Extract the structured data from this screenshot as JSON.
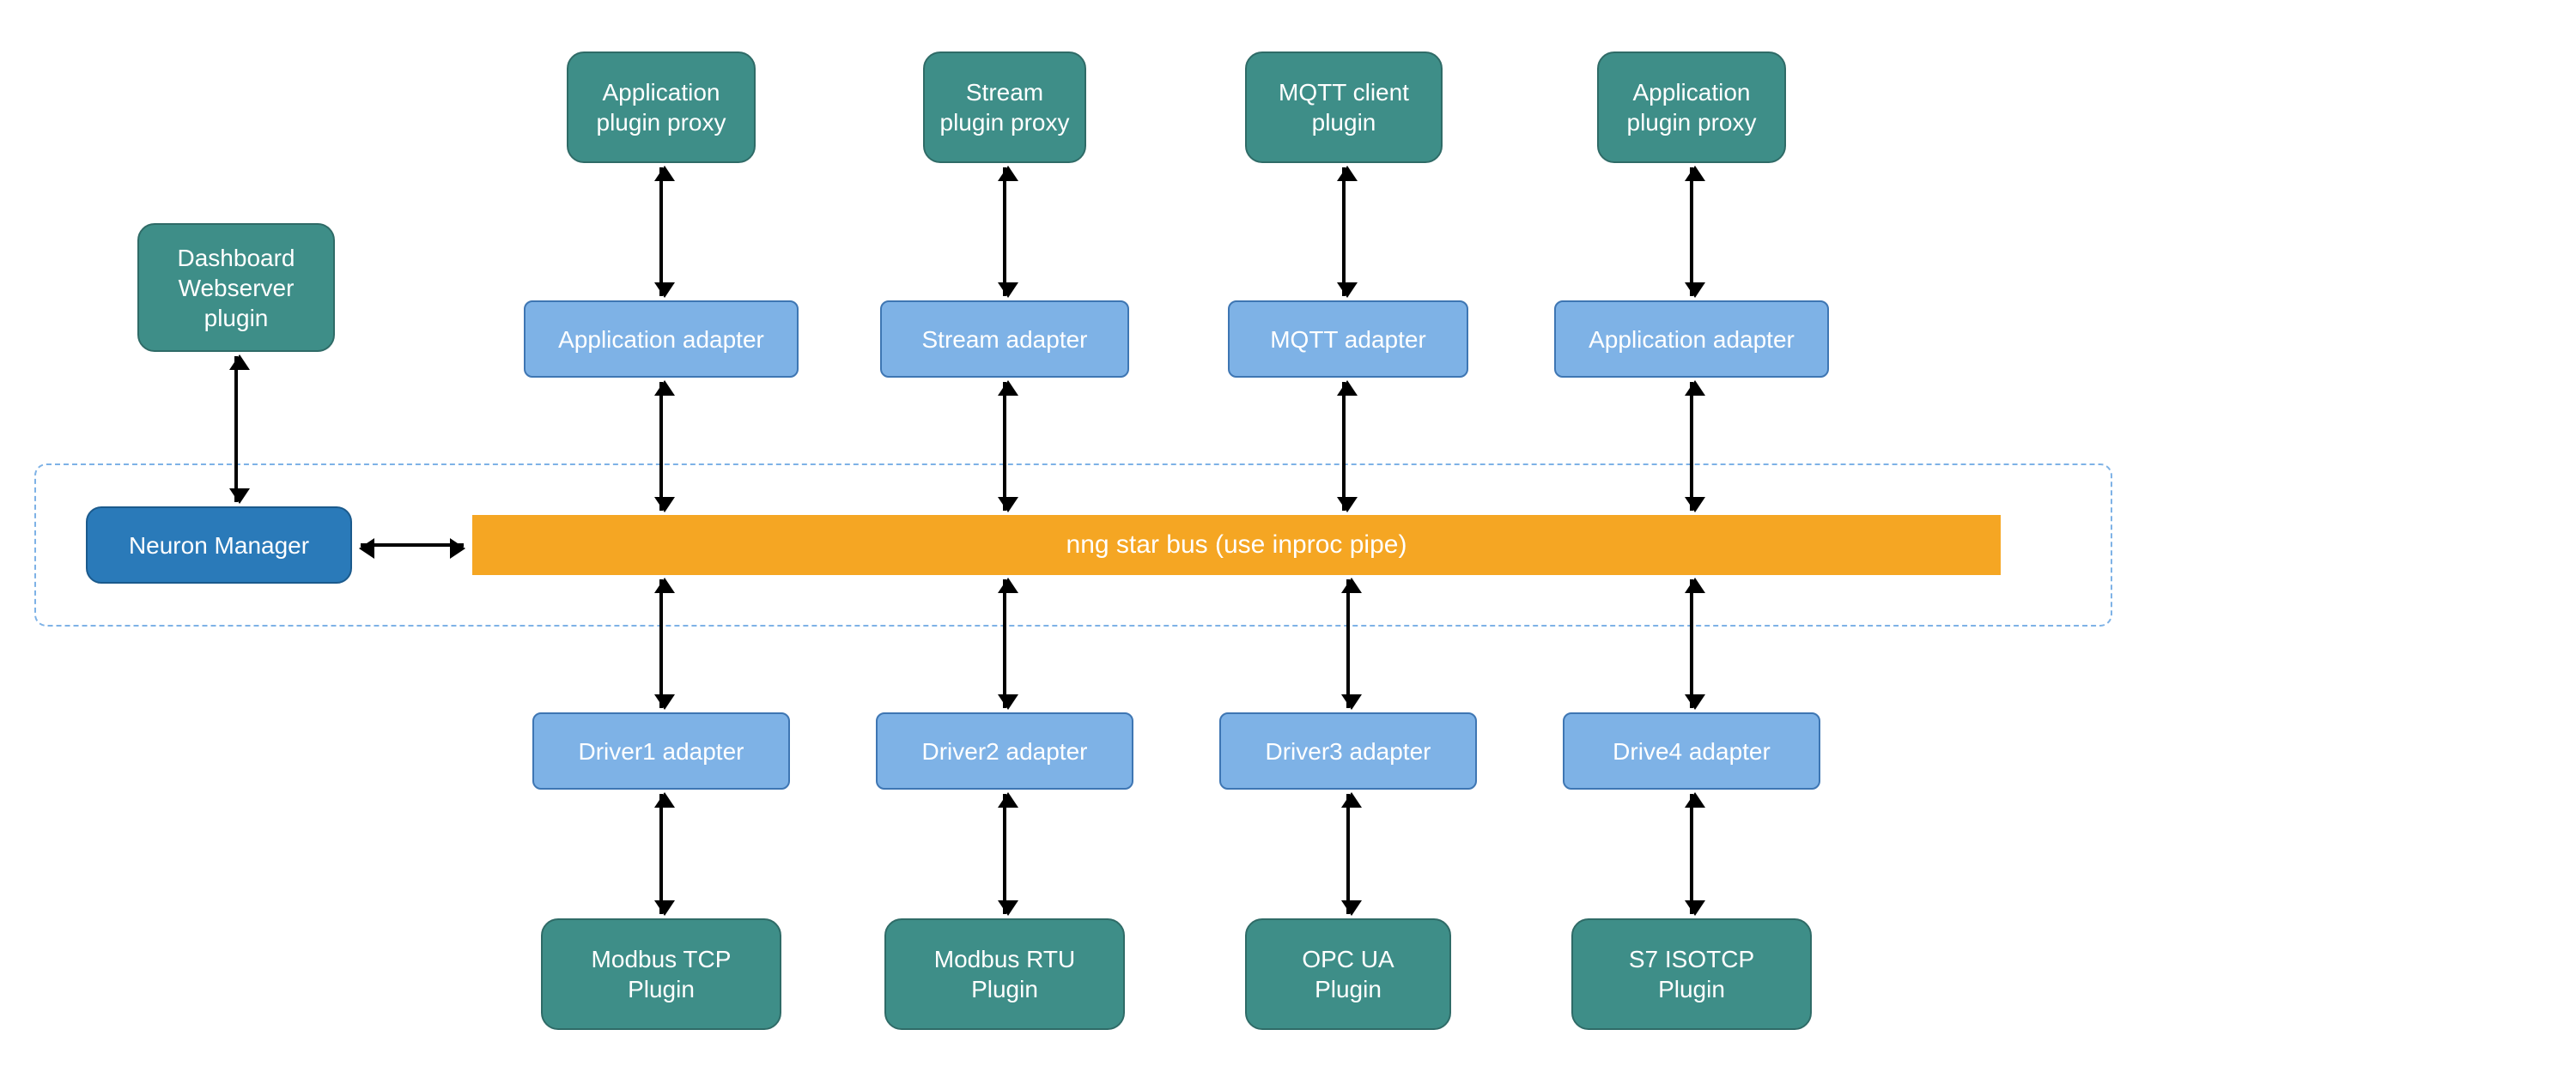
{
  "left": {
    "dashboard_plugin": "Dashboard\nWebserver\nplugin",
    "neuron_manager": "Neuron Manager"
  },
  "top_plugins": [
    "Application\nplugin proxy",
    "Stream\nplugin proxy",
    "MQTT client\nplugin",
    "Application\nplugin proxy"
  ],
  "top_adapters": [
    "Application adapter",
    "Stream  adapter",
    "MQTT adapter",
    "Application adapter"
  ],
  "bus_label": "nng star bus (use inproc pipe)",
  "bottom_adapters": [
    "Driver1 adapter",
    "Driver2 adapter",
    "Driver3 adapter",
    "Drive4 adapter"
  ],
  "bottom_plugins": [
    "Modbus TCP\nPlugin",
    "Modbus RTU\nPlugin",
    "OPC UA\nPlugin",
    "S7 ISOTCP\nPlugin"
  ]
}
